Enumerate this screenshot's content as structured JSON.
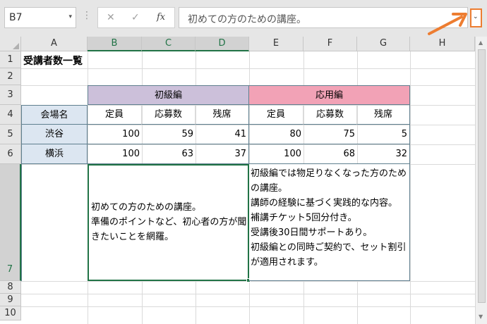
{
  "formula_bar": {
    "name_box": "B7",
    "name_arrow": "▾",
    "dots": "⋮",
    "cancel_glyph": "✕",
    "enter_glyph": "✓",
    "fx_label": "fx",
    "content": "初めての方のための講座。",
    "expand_glyph": "⌄"
  },
  "columns": [
    "A",
    "B",
    "C",
    "D",
    "E",
    "F",
    "G",
    "H"
  ],
  "rows": [
    "1",
    "2",
    "3",
    "4",
    "5",
    "6",
    "7",
    "8",
    "9",
    "10"
  ],
  "sheet": {
    "title": "受講者数一覧",
    "group1": "初級編",
    "group2": "応用編",
    "venue_header": "会場名",
    "sub_headers": [
      "定員",
      "応募数",
      "残席",
      "定員",
      "応募数",
      "残席"
    ],
    "rows": [
      {
        "venue": "渋谷",
        "values": [
          "100",
          "59",
          "41",
          "80",
          "75",
          "5"
        ]
      },
      {
        "venue": "横浜",
        "values": [
          "100",
          "63",
          "37",
          "100",
          "68",
          "32"
        ]
      }
    ],
    "note1": [
      "初めての方のための講座。",
      "準備のポイントなど、初心者の方が聞",
      "きたいことを網羅。"
    ],
    "note2": [
      "初級編では物足りなくなった方のため",
      "の講座。",
      "講師の経験に基づく実践的な内容。",
      "補講チケット5回分付き。",
      "受講後30日間サポートあり。",
      "初級編との同時ご契約で、セット割引",
      "が適用されます。"
    ]
  },
  "colors": {
    "group1_bg": "#ccc0da",
    "group2_bg": "#f2a2b6",
    "header_bg": "#dce6f1",
    "border": "#5f7f8f",
    "selection": "#217346",
    "annotation": "#ed7d31"
  }
}
